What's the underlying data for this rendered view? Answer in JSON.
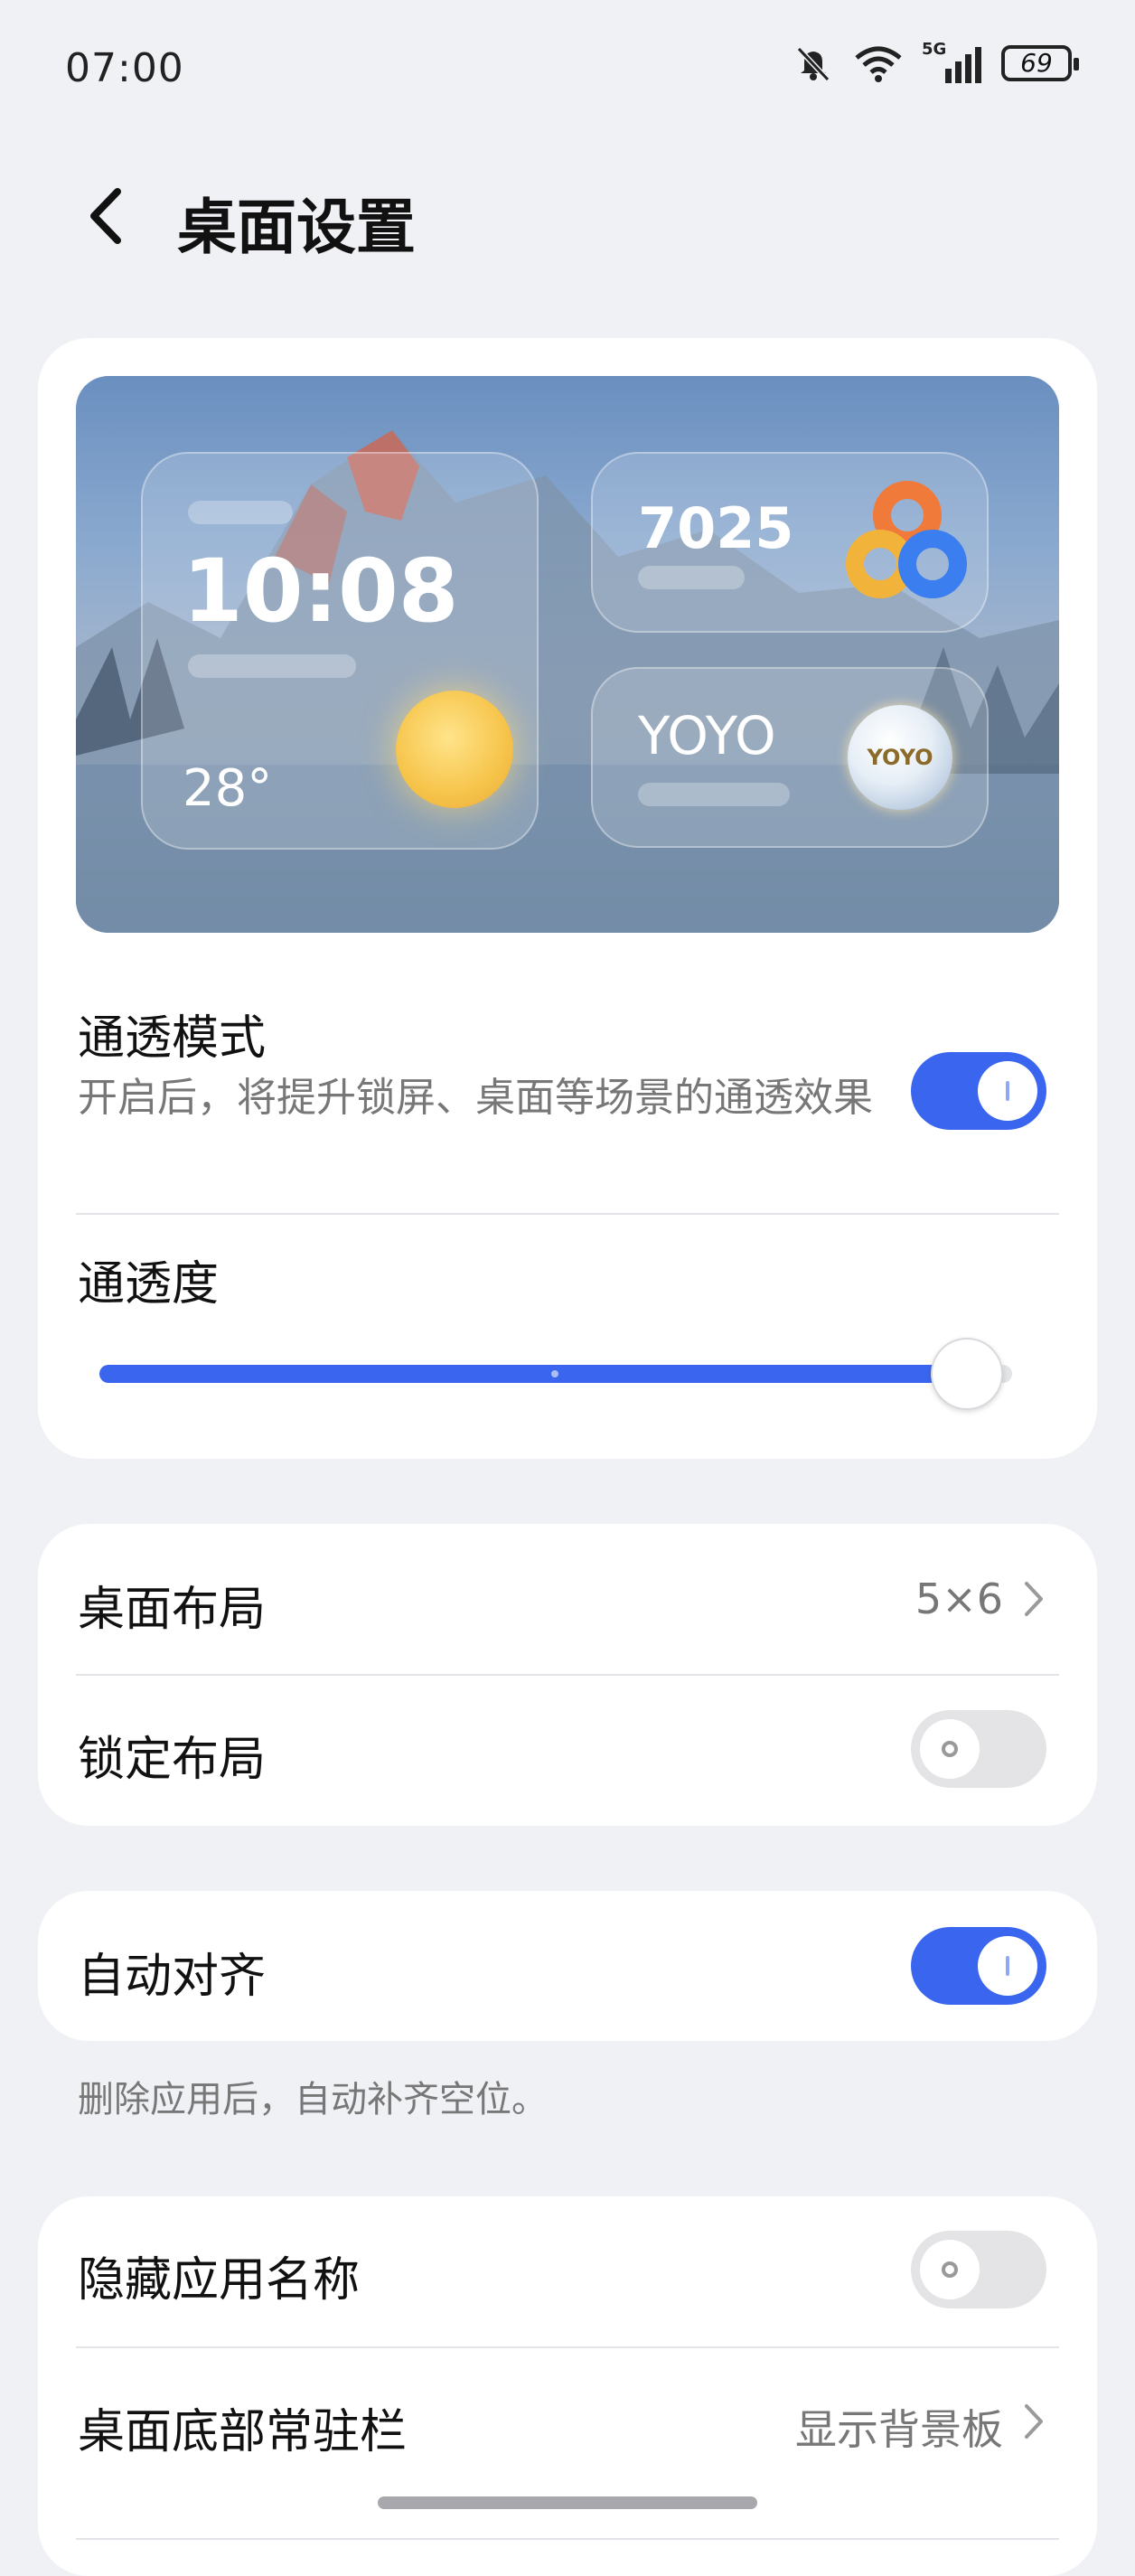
{
  "status_bar": {
    "time": "07:00",
    "network": "5G",
    "battery": "69",
    "icons": [
      "mute-bell-icon",
      "wifi-icon",
      "signal-icon",
      "battery-icon"
    ]
  },
  "header": {
    "title": "桌面设置",
    "back_icon": "back-arrow-icon"
  },
  "preview": {
    "clock_time": "10:08",
    "temperature": "28°",
    "widget_number": "7025",
    "widget_label": "YOYO",
    "yoyo_badge": "YOYO"
  },
  "transparency": {
    "mode_title": "通透模式",
    "mode_description": "开启后，将提升锁屏、桌面等场景的通透效果",
    "mode_enabled": true,
    "level_title": "通透度",
    "level_fraction": 0.95
  },
  "layout_card": {
    "desktop_layout_label": "桌面布局",
    "desktop_layout_value": "5×6",
    "lock_layout_label": "锁定布局",
    "lock_layout_enabled": false
  },
  "auto_align": {
    "label": "自动对齐",
    "enabled": true,
    "hint": "删除应用后，自动补齐空位。"
  },
  "bottom_card": {
    "hide_names_label": "隐藏应用名称",
    "hide_names_enabled": false,
    "dock_label": "桌面底部常驻栏",
    "dock_value": "显示背景板"
  },
  "colors": {
    "accent": "#3a66ef",
    "background": "#f0f1f5",
    "card": "#ffffff"
  }
}
